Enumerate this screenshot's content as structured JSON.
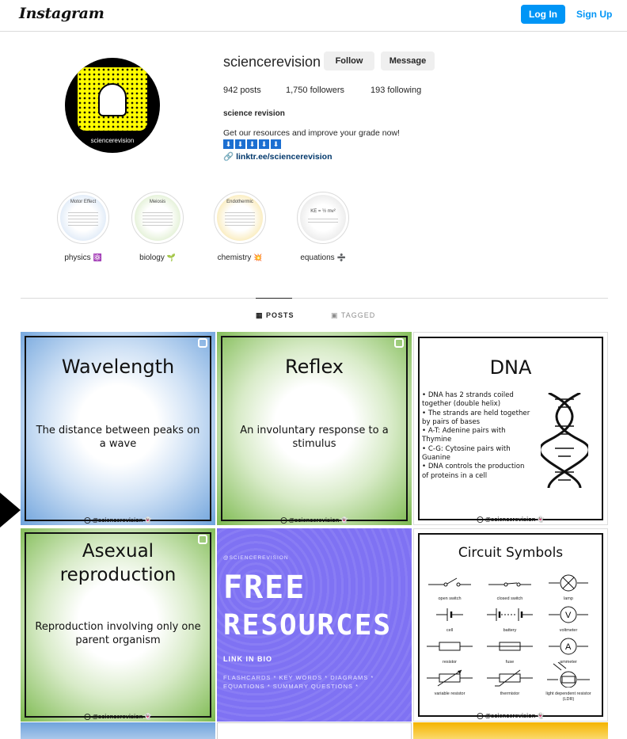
{
  "nav": {
    "logo": "Instagram",
    "login": "Log In",
    "signup": "Sign Up"
  },
  "profile": {
    "avatar_text": "sciencerevision",
    "username": "sciencerevision",
    "follow": "Follow",
    "message": "Message",
    "posts": "942 posts",
    "followers": "1,750 followers",
    "following": "193 following",
    "full_name": "science revision",
    "bio": "Get our resources and improve your grade now!",
    "bio_arrows": [
      "⬇",
      "⬇",
      "⬇",
      "⬇",
      "⬇"
    ],
    "link": "linktr.ee/sciencerevision"
  },
  "highlights": [
    {
      "label": "physics",
      "emoji": "⚛️",
      "cover_title": "Motor Effect"
    },
    {
      "label": "biology",
      "emoji": "🌱",
      "cover_title": "Meiosis"
    },
    {
      "label": "chemistry",
      "emoji": "💥",
      "cover_title": "Endothermic"
    },
    {
      "label": "equations",
      "emoji": "➗",
      "cover_title": "KE = ½ mv²"
    }
  ],
  "tabs": {
    "posts": "POSTS",
    "tagged": "TAGGED",
    "posts_icon": "grid-icon",
    "tagged_icon": "tag-icon"
  },
  "posts": {
    "wavelength": {
      "title": "Wavelength",
      "body": "The distance between peaks on a wave",
      "handle": "@sciencerevision"
    },
    "reflex": {
      "title": "Reflex",
      "body": "An involuntary response to a stimulus",
      "handle": "@sciencerevision"
    },
    "dna": {
      "title": "DNA",
      "points": [
        "DNA has 2 strands coiled together (double helix)",
        "The strands are held together by pairs of bases",
        "A-T: Adenine pairs with Thymine",
        "C-G: Cytosine pairs with Guanine",
        "DNA controls the production of proteins in a cell"
      ],
      "handle": "@sciencerevision"
    },
    "asexual": {
      "title": "Asexual reproduction",
      "body": "Reproduction involving only one parent organism",
      "handle": "@sciencerevision"
    },
    "free": {
      "handle": "@SCIENCEREVISION",
      "line1": "FREE",
      "line2": "RESOURCES",
      "sub": "LINK IN BIO",
      "small": "FLASHCARDS * KEY WORDS * DIAGRAMS * EQUATIONS * SUMMARY QUESTIONS *"
    },
    "circuit": {
      "title": "Circuit Symbols",
      "labels": [
        "open switch",
        "closed switch",
        "lamp",
        "cell",
        "battery",
        "voltmeter",
        "resistor",
        "fuse",
        "ammeter",
        "variable resistor",
        "thermistor",
        "light dependent resistor (LDR)"
      ],
      "handle": "@sciencerevision"
    }
  },
  "colors": {
    "accent": "#0095f6",
    "link": "#00376b",
    "free_bg": "#7f72f3"
  }
}
